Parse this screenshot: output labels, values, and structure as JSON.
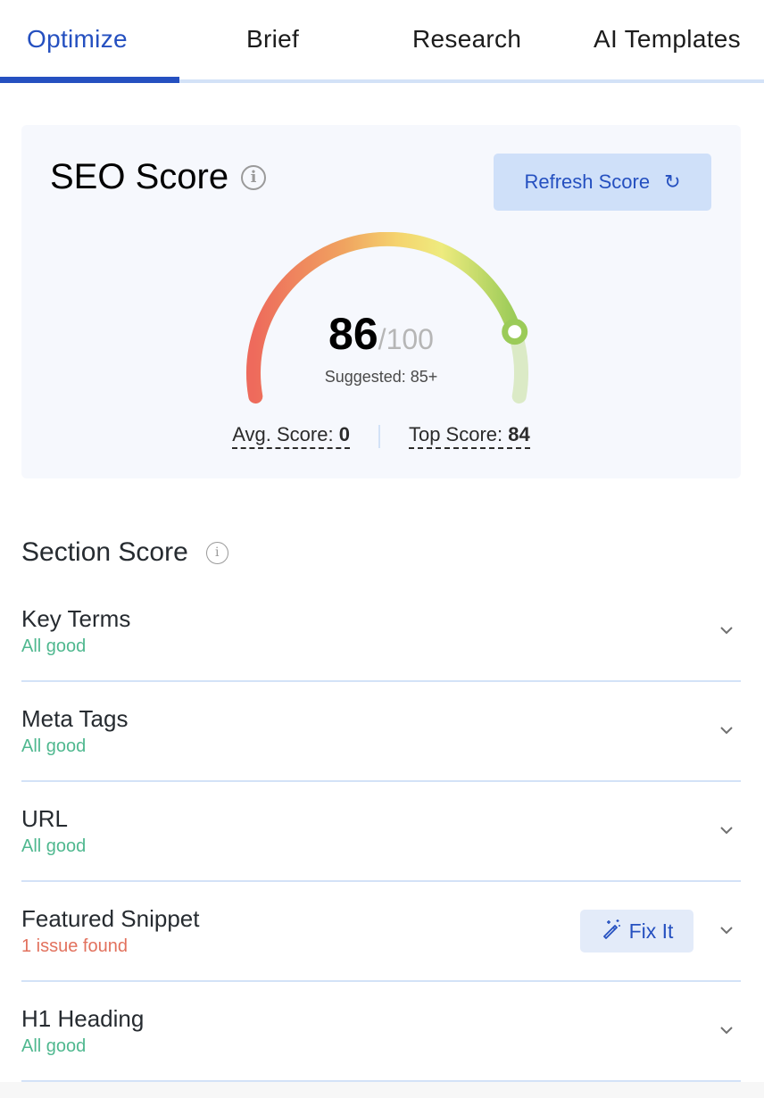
{
  "tabs": [
    {
      "label": "Optimize",
      "active": true
    },
    {
      "label": "Brief",
      "active": false
    },
    {
      "label": "Research",
      "active": false
    },
    {
      "label": "AI Templates",
      "active": false
    }
  ],
  "seo_score": {
    "title": "SEO Score",
    "refresh_label": "Refresh Score",
    "score": "86",
    "max": "/100",
    "score_value": 86,
    "score_max_value": 100,
    "suggested": "Suggested: 85+",
    "avg_label": "Avg. Score: ",
    "avg_value": "0",
    "top_label": "Top Score: ",
    "top_value": "84",
    "colors": {
      "low": "#ee6a5c",
      "mid": "#f5c36a",
      "high": "#eeeb7e",
      "good": "#9bcb58"
    }
  },
  "section_score": {
    "title": "Section Score",
    "rows": [
      {
        "name": "Key Terms",
        "status": "All good",
        "state": "good"
      },
      {
        "name": "Meta Tags",
        "status": "All good",
        "state": "good"
      },
      {
        "name": "URL",
        "status": "All good",
        "state": "good"
      },
      {
        "name": "Featured Snippet",
        "status": "1 issue found",
        "state": "issue",
        "action": "Fix It"
      },
      {
        "name": "H1 Heading",
        "status": "All good",
        "state": "good"
      }
    ]
  }
}
